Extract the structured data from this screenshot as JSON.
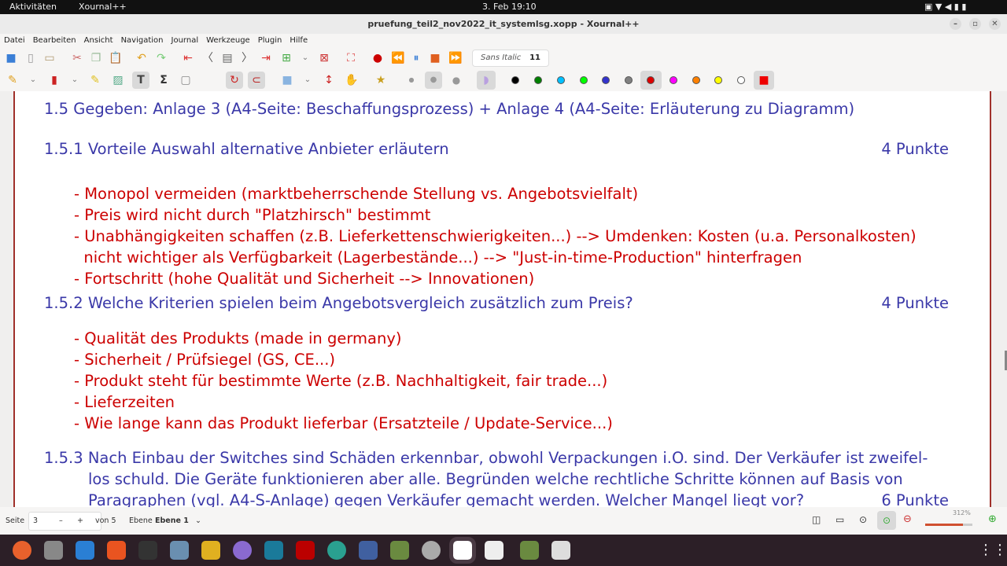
{
  "system": {
    "activities": "Aktivitäten",
    "app": "Xournal++",
    "clock": "3. Feb 19:10"
  },
  "window": {
    "title": "pruefung_teil2_nov2022_it_systemlsg.xopp - Xournal++"
  },
  "menu": [
    "Datei",
    "Bearbeiten",
    "Ansicht",
    "Navigation",
    "Journal",
    "Werkzeuge",
    "Plugin",
    "Hilfe"
  ],
  "font": {
    "name": "Sans Italic",
    "size": "11"
  },
  "colors": [
    "#000000",
    "#008000",
    "#00c0ff",
    "#00ff00",
    "#3333cc",
    "#808080",
    "#ff0000",
    "#ff00ff",
    "#ff8000",
    "#ffff00",
    "#ffffff"
  ],
  "doc": {
    "heading": "1.5 Gegeben: Anlage 3 (A4-Seite: Beschaffungsprozess) + Anlage 4 (A4-Seite: Erläuterung zu Diagramm)",
    "q1": {
      "title": "1.5.1 Vorteile Auswahl alternative Anbieter erläutern",
      "points": "4 Punkte",
      "answers": [
        "- Monopol vermeiden (marktbeherrschende Stellung vs. Angebotsvielfalt)",
        "- Preis wird nicht durch \"Platzhirsch\" bestimmt",
        "- Unabhängigkeiten schaffen (z.B. Lieferkettenschwierigkeiten...) --> Umdenken: Kosten (u.a. Personalkosten)",
        "  nicht wichtiger als Verfügbarkeit (Lagerbestände...) --> \"Just-in-time-Production\" hinterfragen",
        "- Fortschritt (hohe Qualität und Sicherheit --> Innovationen)"
      ]
    },
    "q2": {
      "title": "1.5.2 Welche Kriterien spielen beim Angebotsvergleich zusätzlich zum Preis?",
      "points": "4 Punkte",
      "answers": [
        "- Qualität des Produkts (made in germany)",
        "- Sicherheit / Prüfsiegel (GS, CE...)",
        "- Produkt steht für bestimmte Werte (z.B. Nachhaltigkeit, fair trade...)",
        "- Lieferzeiten",
        "- Wie lange kann das Produkt lieferbar (Ersatzteile / Update-Service...)"
      ]
    },
    "q3": {
      "lines": [
        "1.5.3 Nach Einbau der Switches sind Schäden erkennbar, obwohl Verpackungen i.O. sind. Der Verkäufer ist zweifel-",
        "los schuld. Die Geräte funktionieren aber alle. Begründen welche rechtliche Schritte können auf Basis von",
        "Paragraphen (vgl. A4-S-Anlage) gegen Verkäufer gemacht werden. Welcher Mangel liegt vor?"
      ],
      "points": "6 Punkte"
    }
  },
  "status": {
    "page_label": "Seite",
    "page": "3",
    "minus": "–",
    "plus": "+",
    "of": "von 5",
    "layer_label": "Ebene",
    "layer": "Ebene 1",
    "zoom": "312%",
    "zoom_fraction": 0.8
  }
}
